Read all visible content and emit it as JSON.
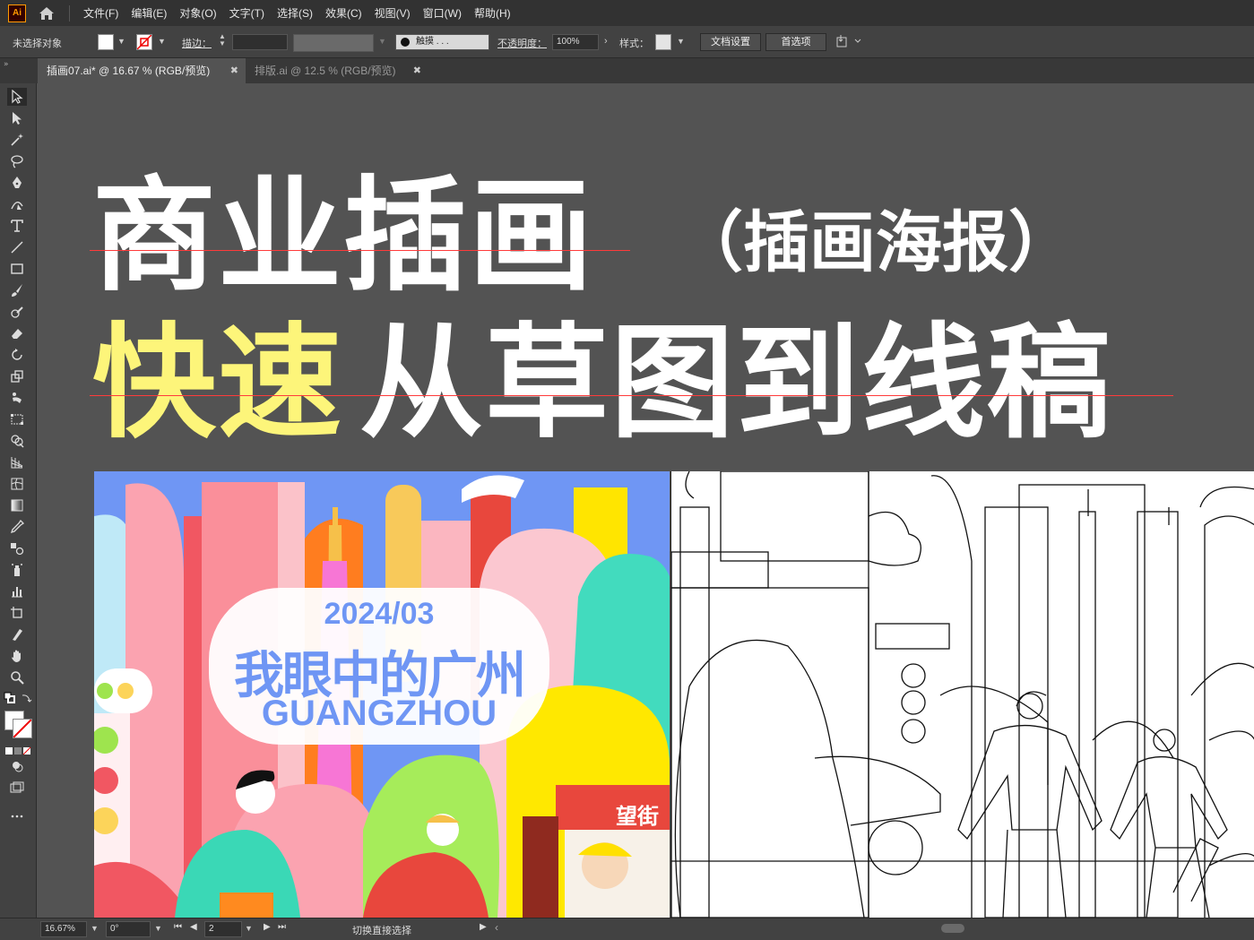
{
  "menubar": {
    "app_badge": "Ai",
    "items": [
      "文件(F)",
      "编辑(E)",
      "对象(O)",
      "文字(T)",
      "选择(S)",
      "效果(C)",
      "视图(V)",
      "窗口(W)",
      "帮助(H)"
    ]
  },
  "controlbar": {
    "selection_status": "未选择对象",
    "stroke_label": "描边：",
    "brush_label": "触摸 . . .",
    "opacity_label": "不透明度：",
    "opacity_value": "100%",
    "style_label": "样式：",
    "doc_setup_button": "文档设置",
    "preferences_button": "首选项"
  },
  "tabs": [
    {
      "label": "插画07.ai* @ 16.67 % (RGB/预览)",
      "active": true
    },
    {
      "label": "排版.ai @ 12.5 % (RGB/预览)",
      "active": false
    }
  ],
  "canvas": {
    "title_line1": "商业插画",
    "subtitle": "（插画海报）",
    "title_line2_highlight": "快速",
    "title_line2_rest": "从草图到线稿",
    "colors": {
      "highlight": "#fdf57a",
      "title": "#ffffff",
      "guide": "#ff3b3b"
    }
  },
  "artwork": {
    "date": "2024/03",
    "heading": "我眼中的广州",
    "city": "GUANGZHOU",
    "shop_sign": "望街"
  },
  "statusbar": {
    "zoom": "16.67%",
    "rotation": "0°",
    "artboard_number": "2",
    "current_tool": "切换直接选择"
  },
  "toolbar": {
    "tools": [
      "selection-tool",
      "direct-selection-tool",
      "magic-wand-tool",
      "lasso-tool",
      "pen-tool",
      "curvature-tool",
      "type-tool",
      "line-tool",
      "rectangle-tool",
      "paintbrush-tool",
      "shaper-tool",
      "eraser-tool",
      "rotate-tool",
      "scale-tool",
      "puppet-warp-tool",
      "free-transform-tool",
      "shape-builder-tool",
      "perspective-grid-tool",
      "mesh-tool",
      "gradient-tool",
      "eyedropper-tool",
      "blend-tool",
      "symbol-sprayer-tool",
      "column-graph-tool",
      "artboard-tool",
      "slice-tool",
      "hand-tool",
      "zoom-tool"
    ]
  }
}
